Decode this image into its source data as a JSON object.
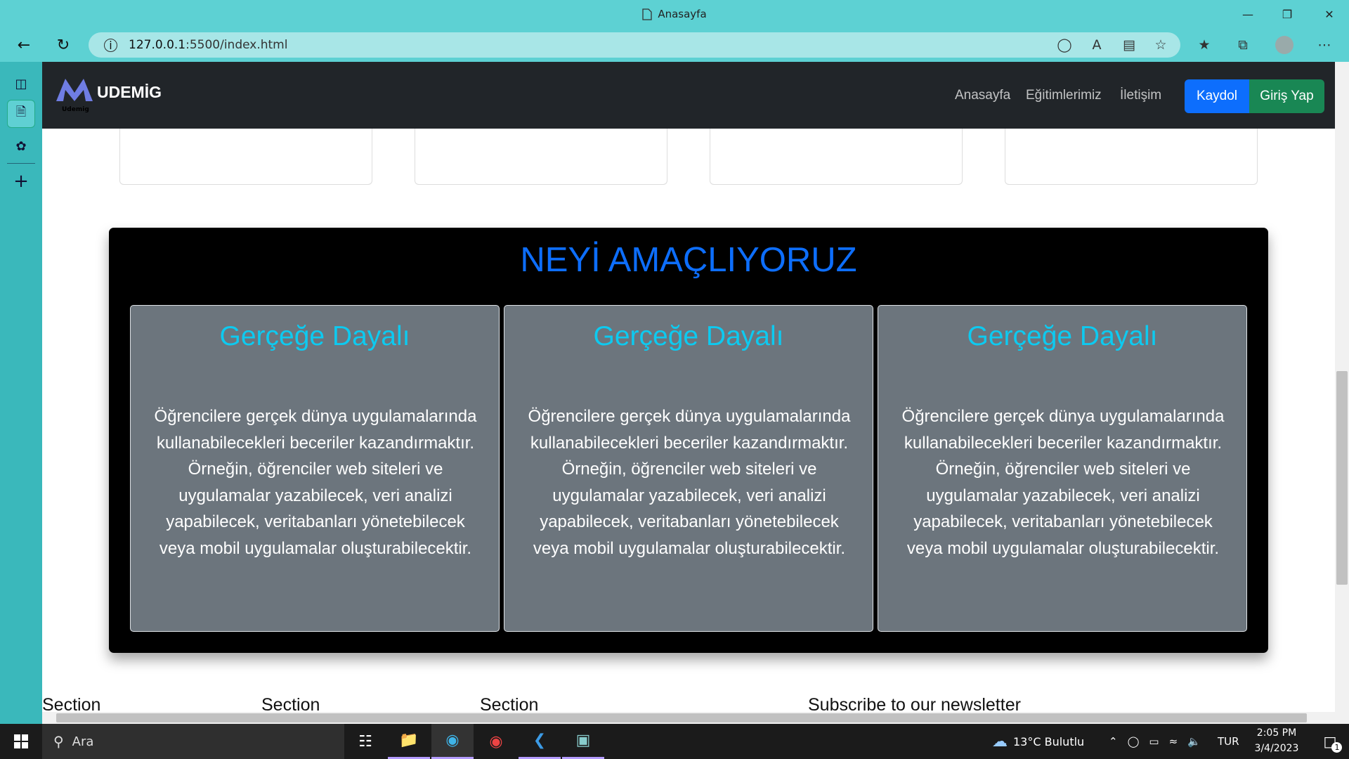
{
  "browser": {
    "tab_title": "Anasayfa",
    "url_host": "127.0.0.1",
    "url_rest": ":5500/index.html",
    "icons": [
      "back-icon",
      "refresh-icon",
      "info-icon",
      "tag-icon",
      "read-aloud-icon",
      "immersive-reader-icon",
      "add-favorite-icon",
      "favorites-icon",
      "collections-icon",
      "profile-icon",
      "more-icon"
    ]
  },
  "site": {
    "brand": "UDEMİG",
    "logo_small": "Udemig",
    "nav_links": [
      "Anasayfa",
      "Eğitimlerimiz",
      "İletişim"
    ],
    "btn_signup": "Kaydol",
    "btn_login": "Giriş Yap",
    "section_title": "NEYİ AMAÇLIYORUZ",
    "features": [
      {
        "title": "Gerçeğe Dayalı",
        "text": "Öğrencilere gerçek dünya uygulamalarında kullanabilecekleri beceriler kazandırmaktır. Örneğin, öğrenciler web siteleri ve uygulamalar yazabilecek, veri analizi yapabilecek, veritabanları yönetebilecek veya mobil uygulamalar oluşturabilecektir."
      },
      {
        "title": "Gerçeğe Dayalı",
        "text": "Öğrencilere gerçek dünya uygulamalarında kullanabilecekleri beceriler kazandırmaktır. Örneğin, öğrenciler web siteleri ve uygulamalar yazabilecek, veri analizi yapabilecek, veritabanları yönetebilecek veya mobil uygulamalar oluşturabilecektir."
      },
      {
        "title": "Gerçeğe Dayalı",
        "text": "Öğrencilere gerçek dünya uygulamalarında kullanabilecekleri beceriler kazandırmaktır. Örneğin, öğrenciler web siteleri ve uygulamalar yazabilecek, veri analizi yapabilecek, veritabanları yönetebilecek veya mobil uygulamalar oluşturabilecektir."
      }
    ],
    "footer_headings": [
      "Section",
      "Section",
      "Section",
      "Subscribe to our newsletter"
    ],
    "colors": {
      "navbar": "#212529",
      "primary": "#0d6efd",
      "success": "#198754",
      "info": "#0dcaf0",
      "card": "#6c757d"
    }
  },
  "taskbar": {
    "search_placeholder": "Ara",
    "weather": "13°C  Bulutlu",
    "language": "TUR",
    "time": "2:05 PM",
    "date": "3/4/2023",
    "notification_count": "1"
  }
}
